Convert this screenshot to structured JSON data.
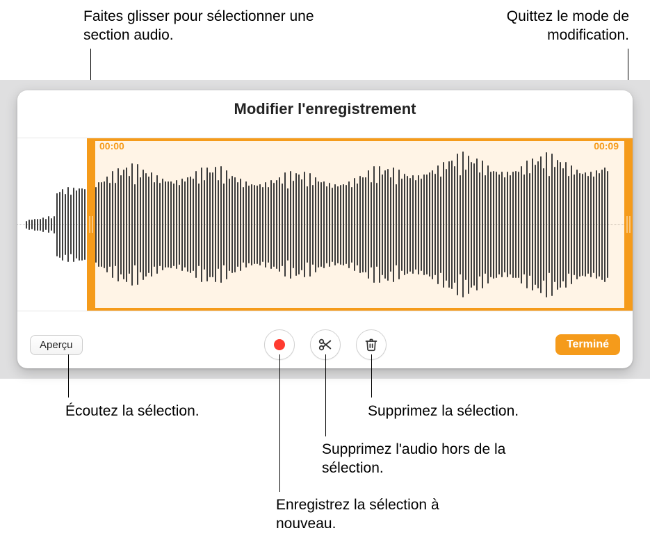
{
  "callouts": {
    "drag_select": "Faites glisser pour sélectionner une section audio.",
    "exit_edit": "Quittez le mode de modification.",
    "listen": "Écoutez la sélection.",
    "rerecord": "Enregistrez la sélection à nouveau.",
    "trim_outside": "Supprimez l'audio hors de la sélection.",
    "delete_sel": "Supprimez la sélection."
  },
  "panel": {
    "title": "Modifier l'enregistrement",
    "time_start": "00:00",
    "time_end": "00:09",
    "preview_label": "Aperçu",
    "done_label": "Terminé"
  },
  "colors": {
    "accent": "#f59b1b"
  }
}
